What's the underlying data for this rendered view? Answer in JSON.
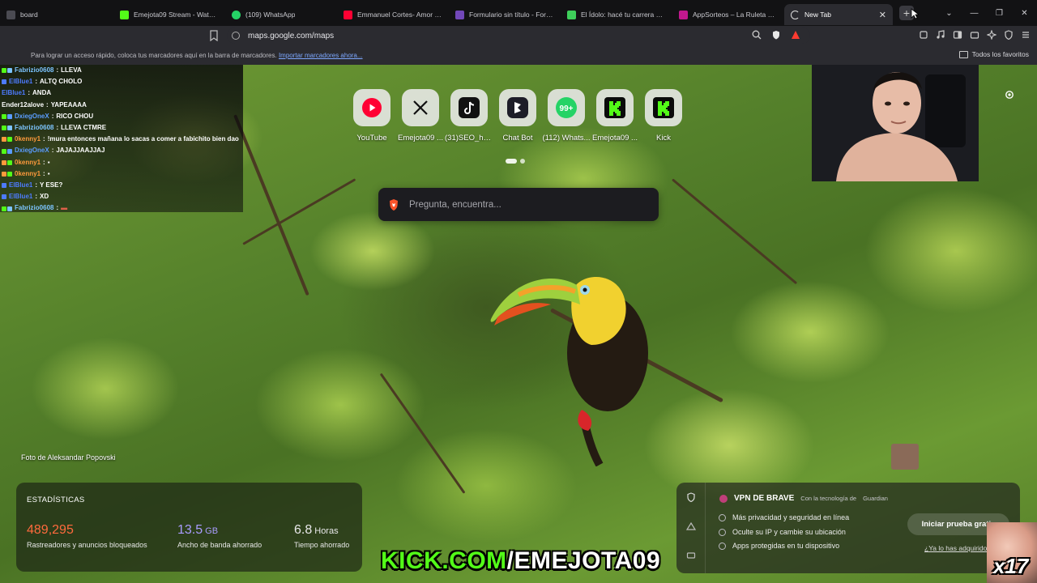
{
  "tabs": [
    {
      "label": "board",
      "color": "#4b4b52"
    },
    {
      "label": "Emejota09 Stream - Watch Live",
      "color": "#53fc18"
    },
    {
      "label": "(109) WhatsApp",
      "color": "#25d366"
    },
    {
      "label": "Emmanuel Cortes- Amor (Official",
      "color": "#ff0033"
    },
    {
      "label": "Formulario sin título - Formula",
      "color": "#7248b9"
    },
    {
      "label": "El Ídolo: hacé tu carrera en la",
      "color": "#3ecf5a"
    },
    {
      "label": "AppSorteos – La Ruleta de la S",
      "color": "#c2188e"
    },
    {
      "label": "New Tab",
      "color": "#ffffff"
    }
  ],
  "address": {
    "url": "maps.google.com/maps"
  },
  "bookmarks": {
    "hint": "Para lograr un acceso rápido, coloca tus marcadores aquí en la barra de marcadores.",
    "import_link": "Importar marcadores ahora...",
    "all_favorites": "Todos los favoritos"
  },
  "chat": [
    {
      "user": "Fabrizio0608",
      "msg": "LLEVA",
      "color": "#7cc4ff"
    },
    {
      "user": "ElBlue1",
      "msg": "ALTQ CHOLO",
      "color": "#4d7bff"
    },
    {
      "user": "ElBlue1",
      "msg": "ANDA",
      "color": "#4d7bff"
    },
    {
      "user": "Ender12alove",
      "msg": "YAPEAAAA",
      "color": "#ffffff"
    },
    {
      "user": "DxiegOneX",
      "msg": "RICO CHOU",
      "color": "#5a9cff"
    },
    {
      "user": "Fabrizio0608",
      "msg": "LLEVA CTMRE",
      "color": "#7cc4ff"
    },
    {
      "user": "0kenny1",
      "msg": "!mura entonces mañana lo sacas a comer a fabichito bien dao",
      "color": "#ff9a3c"
    },
    {
      "user": "DxiegOneX",
      "msg": "JAJAJJAAJJAJ",
      "color": "#5a9cff"
    },
    {
      "user": "0kenny1",
      "msg": "",
      "color": "#ff9a3c"
    },
    {
      "user": "0kenny1",
      "msg": "",
      "color": "#ff9a3c"
    },
    {
      "user": "ElBlue1",
      "msg": "Y ESE?",
      "color": "#4d7bff"
    },
    {
      "user": "ElBlue1",
      "msg": "XD",
      "color": "#4d7bff"
    },
    {
      "user": "Fabrizio0608",
      "msg": "",
      "color": "#7cc4ff"
    }
  ],
  "shortcuts": [
    {
      "label": "YouTube",
      "icon": "youtube-icon"
    },
    {
      "label": "Emejota09 ...",
      "icon": "x-icon"
    },
    {
      "label": "(31)SEO_ho...",
      "icon": "tiktok-icon"
    },
    {
      "label": "Chat Bot",
      "icon": "chatbot-icon"
    },
    {
      "label": "(112) Whats...",
      "icon": "whatsapp-icon"
    },
    {
      "label": "Emejota09 ...",
      "icon": "kick-icon"
    },
    {
      "label": "Kick",
      "icon": "kick-icon"
    }
  ],
  "whatsapp_badge": "99+",
  "search": {
    "placeholder": "Pregunta, encuentra..."
  },
  "photo_credit": "Foto de Aleksandar Popovski",
  "stats": {
    "title": "ESTADÍSTICAS",
    "trackers": {
      "value": "489,295",
      "label": "Rastreadores y anuncios bloqueados",
      "color": "#ff6a3d"
    },
    "bandwidth": {
      "value": "13.5",
      "unit": "GB",
      "label": "Ancho de banda ahorrado",
      "color": "#a99cff"
    },
    "time": {
      "value": "6.8",
      "unit": "Horas",
      "label": "Tiempo ahorrado",
      "color": "#ffffff"
    }
  },
  "vpn": {
    "title": "VPN DE BRAVE",
    "powered": "Con la tecnología de",
    "partner": "Guardian",
    "features": [
      "Más privacidad y seguridad en línea",
      "Oculte su IP y cambie su ubicación",
      "Apps protegidas en tu dispositivo"
    ],
    "cta": "Iniciar prueba gratis",
    "link": "¿Ya lo has adquirido?"
  },
  "overlay": {
    "kick_green": "KICK.COM",
    "kick_white": "/EMEJOTA09",
    "multiplier": "x17"
  }
}
